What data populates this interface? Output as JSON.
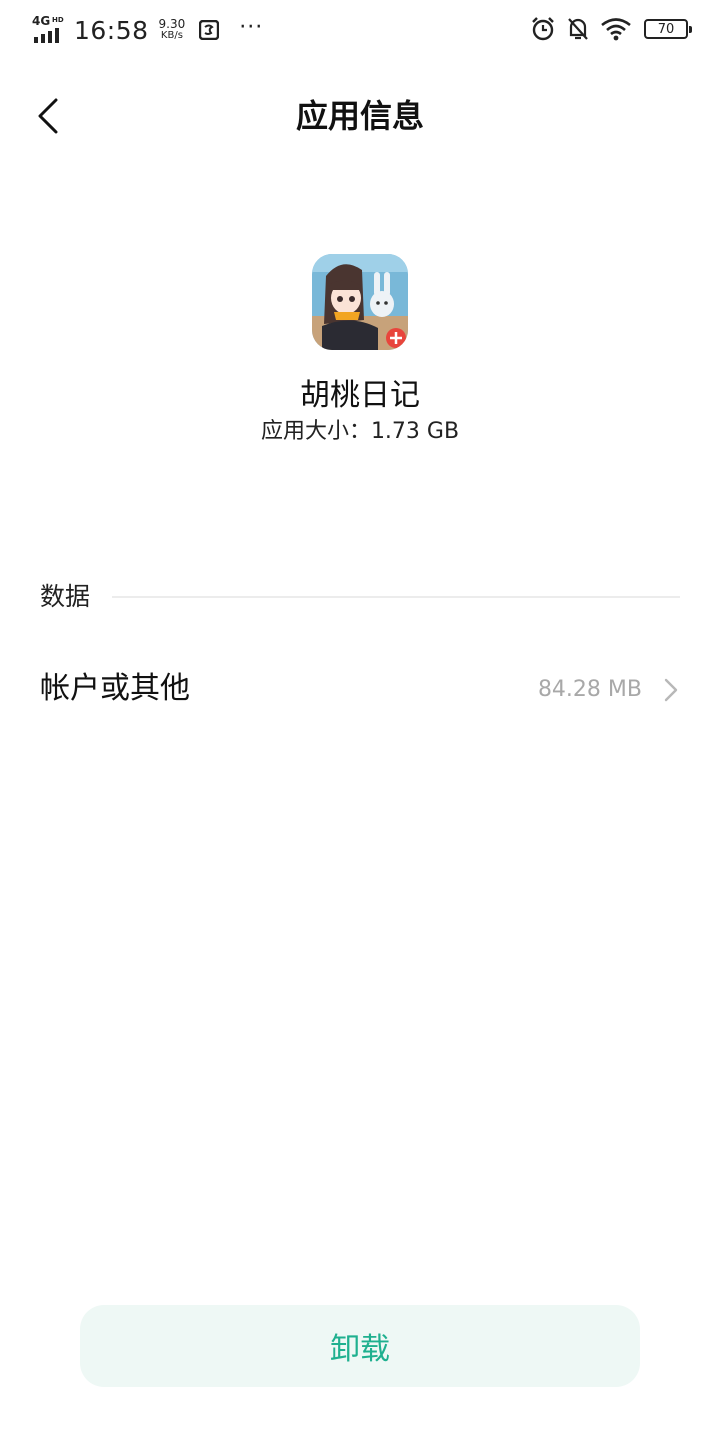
{
  "status_bar": {
    "network": "4G",
    "network_sub": "HD",
    "time": "16:58",
    "speed_value": "9.30",
    "speed_unit": "KB/s",
    "more": "···",
    "battery": "70"
  },
  "header": {
    "title": "应用信息"
  },
  "app": {
    "name": "胡桃日记",
    "size_text": "应用大小：1.73 GB"
  },
  "sections": {
    "data_label": "数据",
    "rows": [
      {
        "label": "帐户或其他",
        "value": "84.28 MB"
      }
    ]
  },
  "actions": {
    "uninstall_label": "卸载"
  },
  "colors": {
    "accent": "#1fb08f",
    "button_bg": "#eef8f5",
    "secondary_text": "#a8a8a8"
  }
}
